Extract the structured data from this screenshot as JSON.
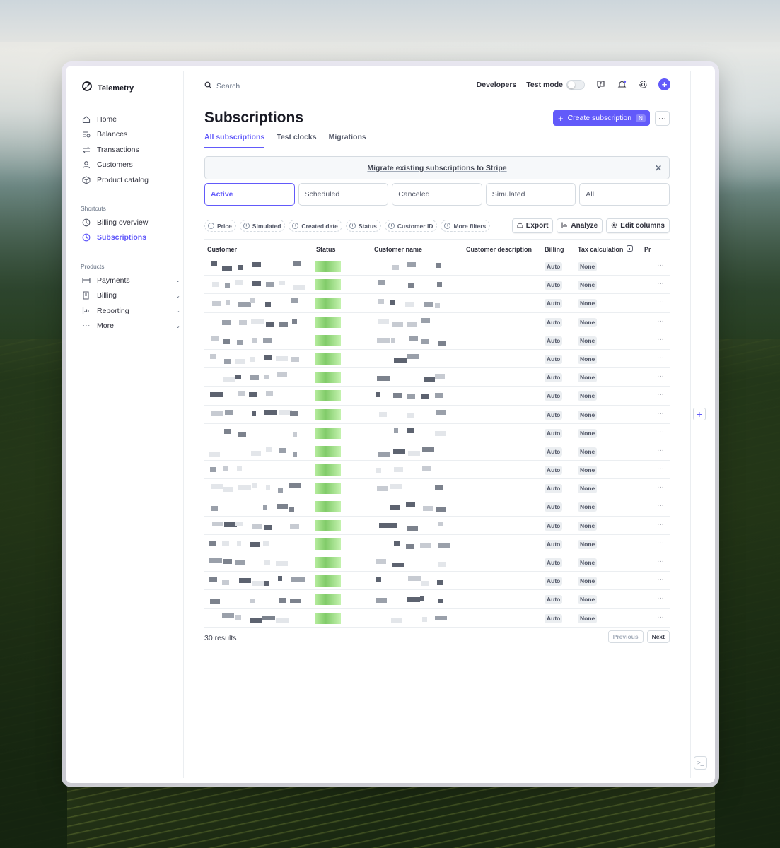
{
  "app": {
    "brand": "Telemetry"
  },
  "sidebar": {
    "items": [
      {
        "label": "Home",
        "icon": "home-icon"
      },
      {
        "label": "Balances",
        "icon": "balances-icon"
      },
      {
        "label": "Transactions",
        "icon": "transactions-icon"
      },
      {
        "label": "Customers",
        "icon": "customers-icon"
      },
      {
        "label": "Product catalog",
        "icon": "product-catalog-icon"
      }
    ],
    "shortcuts_label": "Shortcuts",
    "shortcuts": [
      {
        "label": "Billing overview",
        "icon": "clock-icon"
      },
      {
        "label": "Subscriptions",
        "icon": "clock-icon",
        "active": true
      }
    ],
    "products_label": "Products",
    "products": [
      {
        "label": "Payments",
        "icon": "payments-icon"
      },
      {
        "label": "Billing",
        "icon": "billing-icon"
      },
      {
        "label": "Reporting",
        "icon": "reporting-icon"
      },
      {
        "label": "More",
        "icon": "more-icon"
      }
    ]
  },
  "topbar": {
    "search_placeholder": "Search",
    "developers": "Developers",
    "test_mode": "Test mode"
  },
  "page": {
    "title": "Subscriptions",
    "create_label": "Create subscription",
    "create_shortcut": "N",
    "more_label": "···"
  },
  "tabs": [
    "All subscriptions",
    "Test clocks",
    "Migrations"
  ],
  "banner": {
    "text": "Migrate existing subscriptions to Stripe",
    "close": "✕"
  },
  "status_filters": [
    "Active",
    "Scheduled",
    "Canceled",
    "Simulated",
    "All"
  ],
  "filter_pills": [
    "Price",
    "Simulated",
    "Created date",
    "Status",
    "Customer ID",
    "More filters"
  ],
  "actions": {
    "export": "Export",
    "analyze": "Analyze",
    "edit_columns": "Edit columns"
  },
  "table": {
    "columns": [
      "Customer",
      "Status",
      "Customer name",
      "Customer description",
      "Billing",
      "Tax calculation",
      "Pr"
    ],
    "rows": [
      {
        "billing": "Auto",
        "tax": "None"
      },
      {
        "billing": "Auto",
        "tax": "None"
      },
      {
        "billing": "Auto",
        "tax": "None"
      },
      {
        "billing": "Auto",
        "tax": "None"
      },
      {
        "billing": "Auto",
        "tax": "None"
      },
      {
        "billing": "Auto",
        "tax": "None"
      },
      {
        "billing": "Auto",
        "tax": "None"
      },
      {
        "billing": "Auto",
        "tax": "None"
      },
      {
        "billing": "Auto",
        "tax": "None"
      },
      {
        "billing": "Auto",
        "tax": "None"
      },
      {
        "billing": "Auto",
        "tax": "None"
      },
      {
        "billing": "Auto",
        "tax": "None"
      },
      {
        "billing": "Auto",
        "tax": "None"
      },
      {
        "billing": "Auto",
        "tax": "None"
      },
      {
        "billing": "Auto",
        "tax": "None"
      },
      {
        "billing": "Auto",
        "tax": "None"
      },
      {
        "billing": "Auto",
        "tax": "None"
      },
      {
        "billing": "Auto",
        "tax": "None"
      },
      {
        "billing": "Auto",
        "tax": "None"
      },
      {
        "billing": "Auto",
        "tax": "None"
      }
    ],
    "row_menu": "···"
  },
  "footer": {
    "results": "30 results",
    "previous": "Previous",
    "next": "Next"
  },
  "colors": {
    "accent": "#625afa"
  }
}
